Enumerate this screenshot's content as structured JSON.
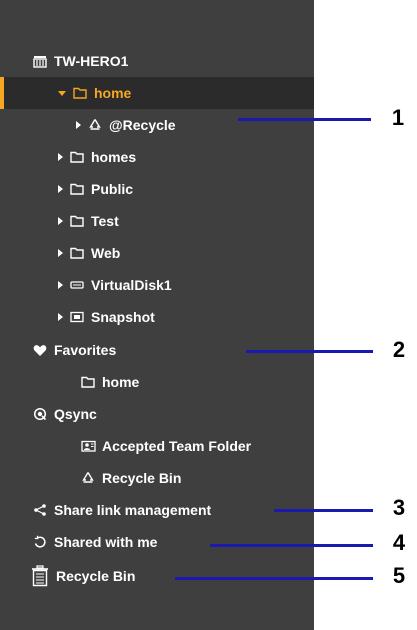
{
  "colors": {
    "sidebar_bg": "#3f3f3f",
    "selected_bg": "#2b2b2b",
    "accent": "#f5a623",
    "callout_line": "#1a1ab0"
  },
  "tree": {
    "nas": {
      "label": "TW-HERO1",
      "icon": "server-icon"
    },
    "home": {
      "label": "home",
      "icon": "folder-icon",
      "expanded": true,
      "selected": true
    },
    "recycle": {
      "label": "@Recycle",
      "icon": "recycle-icon"
    },
    "homes": {
      "label": "homes",
      "icon": "folder-icon"
    },
    "public": {
      "label": "Public",
      "icon": "folder-icon"
    },
    "test": {
      "label": "Test",
      "icon": "folder-icon"
    },
    "web": {
      "label": "Web",
      "icon": "folder-icon"
    },
    "virtualdisk": {
      "label": "VirtualDisk1",
      "icon": "disk-icon"
    },
    "snapshot": {
      "label": "Snapshot",
      "icon": "snapshot-icon"
    }
  },
  "favorites": {
    "label": "Favorites",
    "icon": "heart-icon",
    "items": [
      {
        "label": "home",
        "icon": "folder-icon"
      }
    ]
  },
  "qsync": {
    "label": "Qsync",
    "icon": "qsync-icon",
    "items": [
      {
        "label": "Accepted Team Folder",
        "icon": "team-folder-icon"
      },
      {
        "label": "Recycle Bin",
        "icon": "recycle-icon"
      }
    ]
  },
  "share_link": {
    "label": "Share link management",
    "icon": "share-icon"
  },
  "shared_with_me": {
    "label": "Shared with me",
    "icon": "shared-icon"
  },
  "recycle_bin": {
    "label": "Recycle Bin",
    "icon": "trash-icon"
  },
  "callouts": [
    "1",
    "2",
    "3",
    "4",
    "5"
  ]
}
